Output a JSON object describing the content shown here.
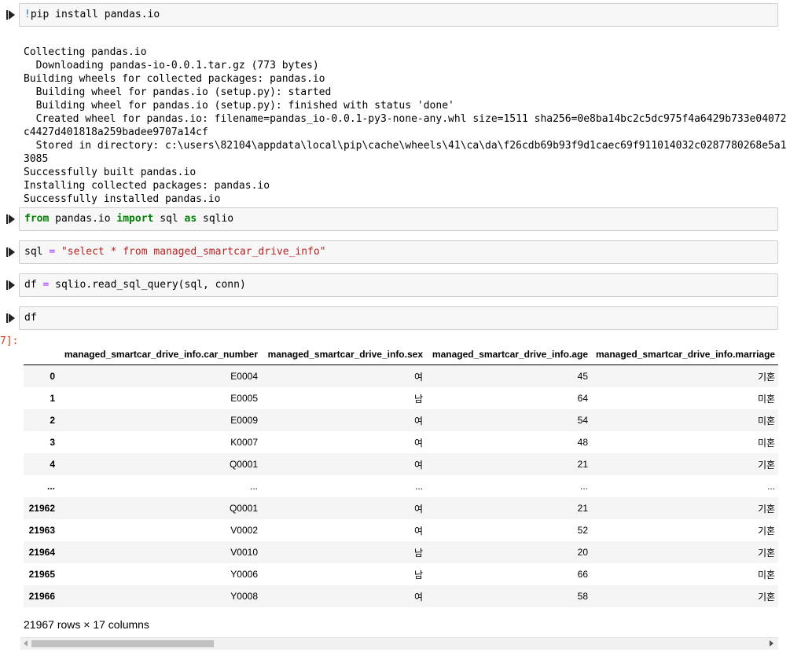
{
  "cells": [
    {
      "code_parts": {
        "bang": "!",
        "rest": "pip install pandas.io"
      }
    },
    {
      "code_parts": {
        "kw1": "from",
        "mod": " pandas.io ",
        "kw2": "import",
        "name": " sql ",
        "kw3": "as",
        "alias": " sqlio"
      }
    },
    {
      "code_parts": {
        "lhs": "sql ",
        "eq": "=",
        "sp": " ",
        "str": "\"select * from managed_smartcar_drive_info\""
      }
    },
    {
      "code_parts": {
        "lhs": "df ",
        "eq": "=",
        "rhs": " sqlio.read_sql_query(sql, conn)"
      }
    },
    {
      "code_parts": {
        "text": "df"
      }
    }
  ],
  "install_output": [
    "Collecting pandas.io",
    "  Downloading pandas-io-0.0.1.tar.gz (773 bytes)",
    "Building wheels for collected packages: pandas.io",
    "  Building wheel for pandas.io (setup.py): started",
    "  Building wheel for pandas.io (setup.py): finished with status 'done'",
    "  Created wheel for pandas.io: filename=pandas_io-0.0.1-py3-none-any.whl size=1511 sha256=0e8ba14bc2c5dc975f4a6429b733e04072",
    "c4427d401818a259badee9707a14cf",
    "  Stored in directory: c:\\users\\82104\\appdata\\local\\pip\\cache\\wheels\\41\\ca\\da\\f26cdb69b93f9d1caec69f911014032c0287780268e5a1",
    "3085",
    "Successfully built pandas.io",
    "Installing collected packages: pandas.io",
    "Successfully installed pandas.io"
  ],
  "out_prompt": "7]:",
  "dataframe": {
    "columns": [
      "managed_smartcar_drive_info.car_number",
      "managed_smartcar_drive_info.sex",
      "managed_smartcar_drive_info.age",
      "managed_smartcar_drive_info.marriage"
    ],
    "rows": [
      {
        "idx": "0",
        "car": "E0004",
        "sex": "여",
        "age": "45",
        "mar": "기혼"
      },
      {
        "idx": "1",
        "car": "E0005",
        "sex": "남",
        "age": "64",
        "mar": "미혼"
      },
      {
        "idx": "2",
        "car": "E0009",
        "sex": "여",
        "age": "54",
        "mar": "미혼"
      },
      {
        "idx": "3",
        "car": "K0007",
        "sex": "여",
        "age": "48",
        "mar": "미혼"
      },
      {
        "idx": "4",
        "car": "Q0001",
        "sex": "여",
        "age": "21",
        "mar": "기혼"
      },
      {
        "idx": "...",
        "car": "...",
        "sex": "...",
        "age": "...",
        "mar": "..."
      },
      {
        "idx": "21962",
        "car": "Q0001",
        "sex": "여",
        "age": "21",
        "mar": "기혼"
      },
      {
        "idx": "21963",
        "car": "V0002",
        "sex": "여",
        "age": "52",
        "mar": "기혼"
      },
      {
        "idx": "21964",
        "car": "V0010",
        "sex": "남",
        "age": "20",
        "mar": "기혼"
      },
      {
        "idx": "21965",
        "car": "Y0006",
        "sex": "남",
        "age": "66",
        "mar": "미혼"
      },
      {
        "idx": "21966",
        "car": "Y0008",
        "sex": "여",
        "age": "58",
        "mar": "기혼"
      }
    ],
    "shape_text": "21967 rows × 17 columns"
  }
}
